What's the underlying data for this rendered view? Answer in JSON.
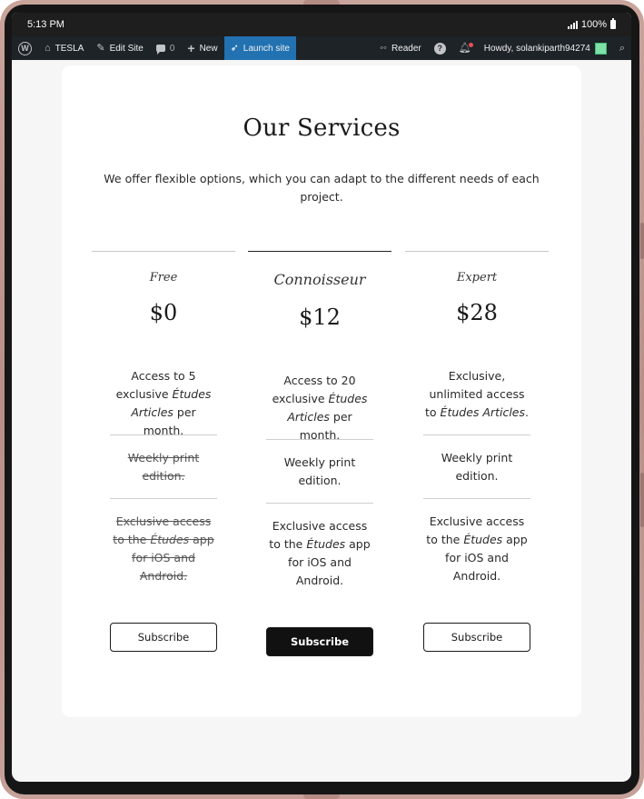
{
  "status": {
    "time": "5:13 PM",
    "battery": "100%"
  },
  "adminbar": {
    "site": "TESLA",
    "edit_site": "Edit Site",
    "comments": "0",
    "new": "New",
    "launch": "Launch site",
    "reader": "Reader",
    "howdy": "Howdy, solankiparth94274"
  },
  "page": {
    "title": "Our Services",
    "intro": "We offer flexible options, which you can adapt to the different needs of each project."
  },
  "plans": [
    {
      "name": "Free",
      "price": "$0",
      "features": [
        {
          "pre": "Access to 5 exclusive ",
          "em": "Études Articles",
          "post": " per month.",
          "struck": false
        },
        {
          "pre": "Weekly print edition.",
          "em": "",
          "post": "",
          "struck": true
        },
        {
          "pre": "Exclusive access to the ",
          "em": "Études",
          "post": " app for iOS and Android.",
          "struck": true
        }
      ],
      "button": "Subscribe"
    },
    {
      "name": "Connoisseur",
      "price": "$12",
      "features": [
        {
          "pre": "Access to 20 exclusive ",
          "em": "Études Articles",
          "post": " per month.",
          "struck": false
        },
        {
          "pre": "Weekly print edition.",
          "em": "",
          "post": "",
          "struck": false
        },
        {
          "pre": "Exclusive access to the ",
          "em": "Études",
          "post": " app for iOS and Android.",
          "struck": false
        }
      ],
      "button": "Subscribe"
    },
    {
      "name": "Expert",
      "price": "$28",
      "features": [
        {
          "pre": "Exclusive, unlimited access to ",
          "em": "Études Articles",
          "post": ".",
          "struck": false
        },
        {
          "pre": "Weekly print edition.",
          "em": "",
          "post": "",
          "struck": false
        },
        {
          "pre": "Exclusive access to the ",
          "em": "Études",
          "post": " app for iOS and Android.",
          "struck": false
        }
      ],
      "button": "Subscribe"
    }
  ]
}
